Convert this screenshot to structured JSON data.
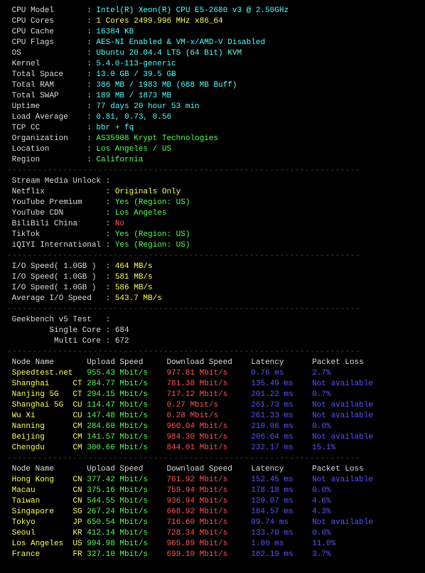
{
  "sysinfo": [
    {
      "label": "CPU Model",
      "value": "Intel(R) Xeon(R) CPU E5-2680 v3 @ 2.50GHz",
      "vclass": "cyan"
    },
    {
      "label": "CPU Cores",
      "value": "1 Cores 2499.996 MHz x86_64",
      "vclass": "yellow"
    },
    {
      "label": "CPU Cache",
      "value": "16384 KB",
      "vclass": "cyan"
    },
    {
      "label": "CPU Flags",
      "value": "AES-NI Enabled & VM-x/AMD-V Disabled",
      "vclass": "cyan"
    },
    {
      "label": "OS",
      "value": "Ubuntu 20.04.4 LTS (64 Bit) KVM",
      "vclass": "cyan"
    },
    {
      "label": "Kernel",
      "value": "5.4.0-113-generic",
      "vclass": "cyan"
    },
    {
      "label": "Total Space",
      "value": "13.0 GB / 39.5 GB",
      "vclass": "cyan"
    },
    {
      "label": "Total RAM",
      "value": "386 MB / 1983 MB (688 MB Buff)",
      "vclass": "cyan"
    },
    {
      "label": "Total SWAP",
      "value": "189 MB / 1873 MB",
      "vclass": "cyan"
    },
    {
      "label": "Uptime",
      "value": "77 days 20 hour 53 min",
      "vclass": "cyan"
    },
    {
      "label": "Load Average",
      "value": "0.81, 0.73, 0.56",
      "vclass": "cyan"
    },
    {
      "label": "TCP CC",
      "value": "bbr + fq",
      "vclass": "cyan"
    },
    {
      "label": "Organization",
      "value": "AS35908 Krypt Technologies",
      "vclass": "green"
    },
    {
      "label": "Location",
      "value": "Los Angeles / US",
      "vclass": "green"
    },
    {
      "label": "Region",
      "value": "California",
      "vclass": "green"
    }
  ],
  "stream_header": "Stream Media Unlock",
  "stream": [
    {
      "label": "Netflix",
      "value": "Originals Only",
      "vclass": "yellow"
    },
    {
      "label": "YouTube Premium",
      "value": "Yes (Region: US)",
      "vclass": "green"
    },
    {
      "label": "YouTube CDN",
      "value": "Los Angeles",
      "vclass": "green"
    },
    {
      "label": "BiliBili China",
      "value": "No",
      "vclass": "red"
    },
    {
      "label": "TikTok",
      "value": "Yes (Region: US)",
      "vclass": "green"
    },
    {
      "label": "iQIYI International",
      "value": "Yes (Region: US)",
      "vclass": "green"
    }
  ],
  "io": [
    {
      "label": "I/O Speed( 1.0GB )",
      "value": "464 MB/s"
    },
    {
      "label": "I/O Speed( 1.0GB )",
      "value": "581 MB/s"
    },
    {
      "label": "I/O Speed( 1.0GB )",
      "value": "586 MB/s"
    },
    {
      "label": "Average I/O Speed",
      "value": "543.7 MB/s"
    }
  ],
  "geekbench": {
    "header": "Geekbench v5 Test",
    "single_label": "Single Core",
    "single_value": "684",
    "multi_label": "Multi Core",
    "multi_value": "672"
  },
  "table_header": {
    "c0": "Node Name",
    "c1": "Upload Speed",
    "c2": "Download Speed",
    "c3": "Latency",
    "c4": "Packet Loss"
  },
  "table1": [
    {
      "name": "Speedtest.net",
      "cc": "",
      "up": "955.43 Mbit/s",
      "dn": "977.81 Mbit/s",
      "lat": "0.76 ms",
      "loss": "2.7%"
    },
    {
      "name": "Shanghai",
      "cc": "CT",
      "up": "284.77 Mbit/s",
      "dn": "781.38 Mbit/s",
      "lat": "135.49 ms",
      "loss": "Not available"
    },
    {
      "name": "Nanjing 5G",
      "cc": "CT",
      "up": "294.15 Mbit/s",
      "dn": "717.12 Mbit/s",
      "lat": "201.22 ms",
      "loss": "0.7%"
    },
    {
      "name": "Shanghai 5G",
      "cc": "CU",
      "up": "114.47 Mbit/s",
      "dn": "0.27 Mbit/s",
      "lat": "261.73 ms",
      "loss": "Not available"
    },
    {
      "name": "Wu Xi",
      "cc": "CU",
      "up": "147.48 Mbit/s",
      "dn": "0.28 Mbit/s",
      "lat": "261.33 ms",
      "loss": "Not available"
    },
    {
      "name": "Nanning",
      "cc": "CM",
      "up": "284.60 Mbit/s",
      "dn": "960.04 Mbit/s",
      "lat": "210.06 ms",
      "loss": "0.0%"
    },
    {
      "name": "Beijing",
      "cc": "CM",
      "up": "141.57 Mbit/s",
      "dn": "984.30 Mbit/s",
      "lat": "206.64 ms",
      "loss": "Not available"
    },
    {
      "name": "Chengdu",
      "cc": "CM",
      "up": "300.66 Mbit/s",
      "dn": "844.01 Mbit/s",
      "lat": "232.17 ms",
      "loss": "15.1%"
    }
  ],
  "table2": [
    {
      "name": "Hong Kong",
      "cc": "CN",
      "up": "377.42 Mbit/s",
      "dn": "761.92 Mbit/s",
      "lat": "152.45 ms",
      "loss": "Not available"
    },
    {
      "name": "Macau",
      "cc": "CN",
      "up": "375.16 Mbit/s",
      "dn": "759.94 Mbit/s",
      "lat": "178.18 ms",
      "loss": "0.0%"
    },
    {
      "name": "Taiwan",
      "cc": "CN",
      "up": "544.55 Mbit/s",
      "dn": "936.94 Mbit/s",
      "lat": "129.07 ms",
      "loss": "4.6%"
    },
    {
      "name": "Singapore",
      "cc": "SG",
      "up": "267.24 Mbit/s",
      "dn": "668.92 Mbit/s",
      "lat": "184.57 ms",
      "loss": "4.3%"
    },
    {
      "name": "Tokyo",
      "cc": "JP",
      "up": "650.54 Mbit/s",
      "dn": "716.60 Mbit/s",
      "lat": "99.74 ms",
      "loss": "Not available"
    },
    {
      "name": "Seoul",
      "cc": "KR",
      "up": "412.14 Mbit/s",
      "dn": "728.34 Mbit/s",
      "lat": "133.70 ms",
      "loss": "0.0%"
    },
    {
      "name": "Los Angeles",
      "cc": "US",
      "up": "994.98 Mbit/s",
      "dn": "965.89 Mbit/s",
      "lat": "1.00 ms",
      "loss": "11.0%"
    },
    {
      "name": "France",
      "cc": "FR",
      "up": "327.10 Mbit/s",
      "dn": "699.10 Mbit/s",
      "lat": "162.19 ms",
      "loss": "3.7%"
    }
  ],
  "sep_line": "----------------------------------------------------------------------"
}
